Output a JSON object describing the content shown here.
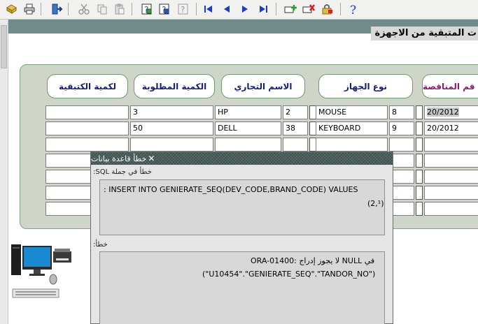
{
  "toolbar": {
    "icons": [
      "save-icon",
      "print-icon",
      "exit-icon",
      "cut-icon",
      "copy-icon",
      "paste-icon",
      "query-icon",
      "execute-query-icon",
      "cancel-query-icon",
      "first-record-icon",
      "previous-record-icon",
      "next-record-icon",
      "last-record-icon",
      "insert-record-icon",
      "delete-record-icon",
      "lock-record-icon",
      "help-icon"
    ]
  },
  "form": {
    "title": "ت المتبقية من الاجهزة"
  },
  "headers": {
    "remaining_qty": "لكمية الكتبقية",
    "required_qty": "الكمية المطلوبة",
    "trade_name": "الاسم التجاري",
    "device_type": "نوع الجهاز",
    "tender_no": "قم المناقصة"
  },
  "rows": [
    {
      "remaining": "",
      "qty": "3",
      "brand": "HP",
      "brand_code": "2",
      "device": "MOUSE",
      "device_code": "8",
      "tender": "20/2012"
    },
    {
      "remaining": "",
      "qty": "50",
      "brand": "DELL",
      "brand_code": "38",
      "device": "KEYBOARD",
      "device_code": "9",
      "tender": "20/2012"
    }
  ],
  "dialog": {
    "title": "خطأ قاعدة بيانات",
    "sql_label": "خطأ في جملة SQL:",
    "sql_line1": ": INSERT INTO GENIERATE_SEQ(DEV_CODE,BRAND_CODE) VALUES",
    "sql_line2": "(2,¹)",
    "error_label": "خطأ:",
    "error_line1": "ORA-01400: لا يجوز إدراج NULL في",
    "error_line2": "(\"U10454\".\"GENIERATE_SEQ\".\"TANDOR_NO\")"
  },
  "colors": {
    "toolbar_bg": "#f1f1ef",
    "form_header": "#6f8b8a",
    "panel_bg": "#cfd6c9",
    "header_text": "#1b1b78",
    "dialog_title": "#3d4d4c"
  }
}
